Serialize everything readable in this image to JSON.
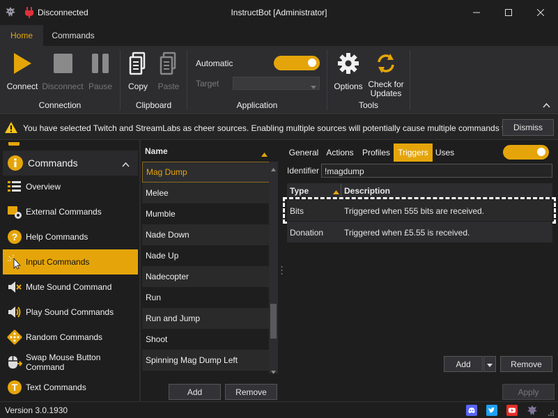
{
  "window": {
    "status": "Disconnected",
    "title": "InstructBot [Administrator]"
  },
  "ribbon_tabs": [
    "Home",
    "Commands"
  ],
  "ribbon": {
    "connection": {
      "label": "Connection",
      "connect": "Connect",
      "disconnect": "Disconnect",
      "pause": "Pause"
    },
    "clipboard": {
      "label": "Clipboard",
      "copy": "Copy",
      "paste": "Paste"
    },
    "application": {
      "label": "Application",
      "automatic": "Automatic",
      "target": "Target",
      "target_value": ""
    },
    "tools": {
      "label": "Tools",
      "options": "Options",
      "check_updates_line1": "Check for",
      "check_updates_line2": "Updates"
    }
  },
  "warning": {
    "text": "You have selected Twitch and StreamLabs as cheer sources. Enabling multiple sources will potentially cause multiple commands to be ...",
    "dismiss": "Dismiss"
  },
  "sidebar": {
    "section": "Commands",
    "items": [
      {
        "label": "Overview",
        "icon": "list-icon"
      },
      {
        "label": "External Commands",
        "icon": "external-icon"
      },
      {
        "label": "Help Commands",
        "icon": "help-icon"
      },
      {
        "label": "Input Commands",
        "icon": "cursor-icon",
        "selected": true
      },
      {
        "label": "Mute Sound Command",
        "icon": "mute-icon"
      },
      {
        "label": "Play Sound Commands",
        "icon": "speaker-icon"
      },
      {
        "label": "Random Commands",
        "icon": "dice-icon"
      },
      {
        "label": "Swap Mouse Button Command",
        "icon": "mouse-icon"
      },
      {
        "label": "Text Commands",
        "icon": "text-icon"
      }
    ]
  },
  "command_list": {
    "header": "Name",
    "items": [
      "Mag Dump",
      "Melee",
      "Mumble",
      "Nade Down",
      "Nade Up",
      "Nadecopter",
      "Run",
      "Run and Jump",
      "Shoot",
      "Spinning Mag Dump Left"
    ],
    "selected_index": 0,
    "add": "Add",
    "remove": "Remove"
  },
  "detail": {
    "tabs": [
      "General",
      "Actions",
      "Profiles",
      "Triggers",
      "Uses"
    ],
    "active_tab": "Triggers",
    "identifier_label": "Identifier",
    "identifier_value": "!magdump",
    "columns": {
      "type": "Type",
      "description": "Description"
    },
    "rows": [
      {
        "type": "Bits",
        "description": "Triggered when 555 bits are received."
      },
      {
        "type": "Donation",
        "description": "Triggered when £5.55 is received."
      }
    ],
    "add": "Add",
    "remove": "Remove",
    "apply": "Apply"
  },
  "statusbar": {
    "version": "Version 3.0.1930"
  },
  "colors": {
    "accent": "#e5a50a",
    "background": "#1e1e1e",
    "panel": "#2d2d30"
  }
}
